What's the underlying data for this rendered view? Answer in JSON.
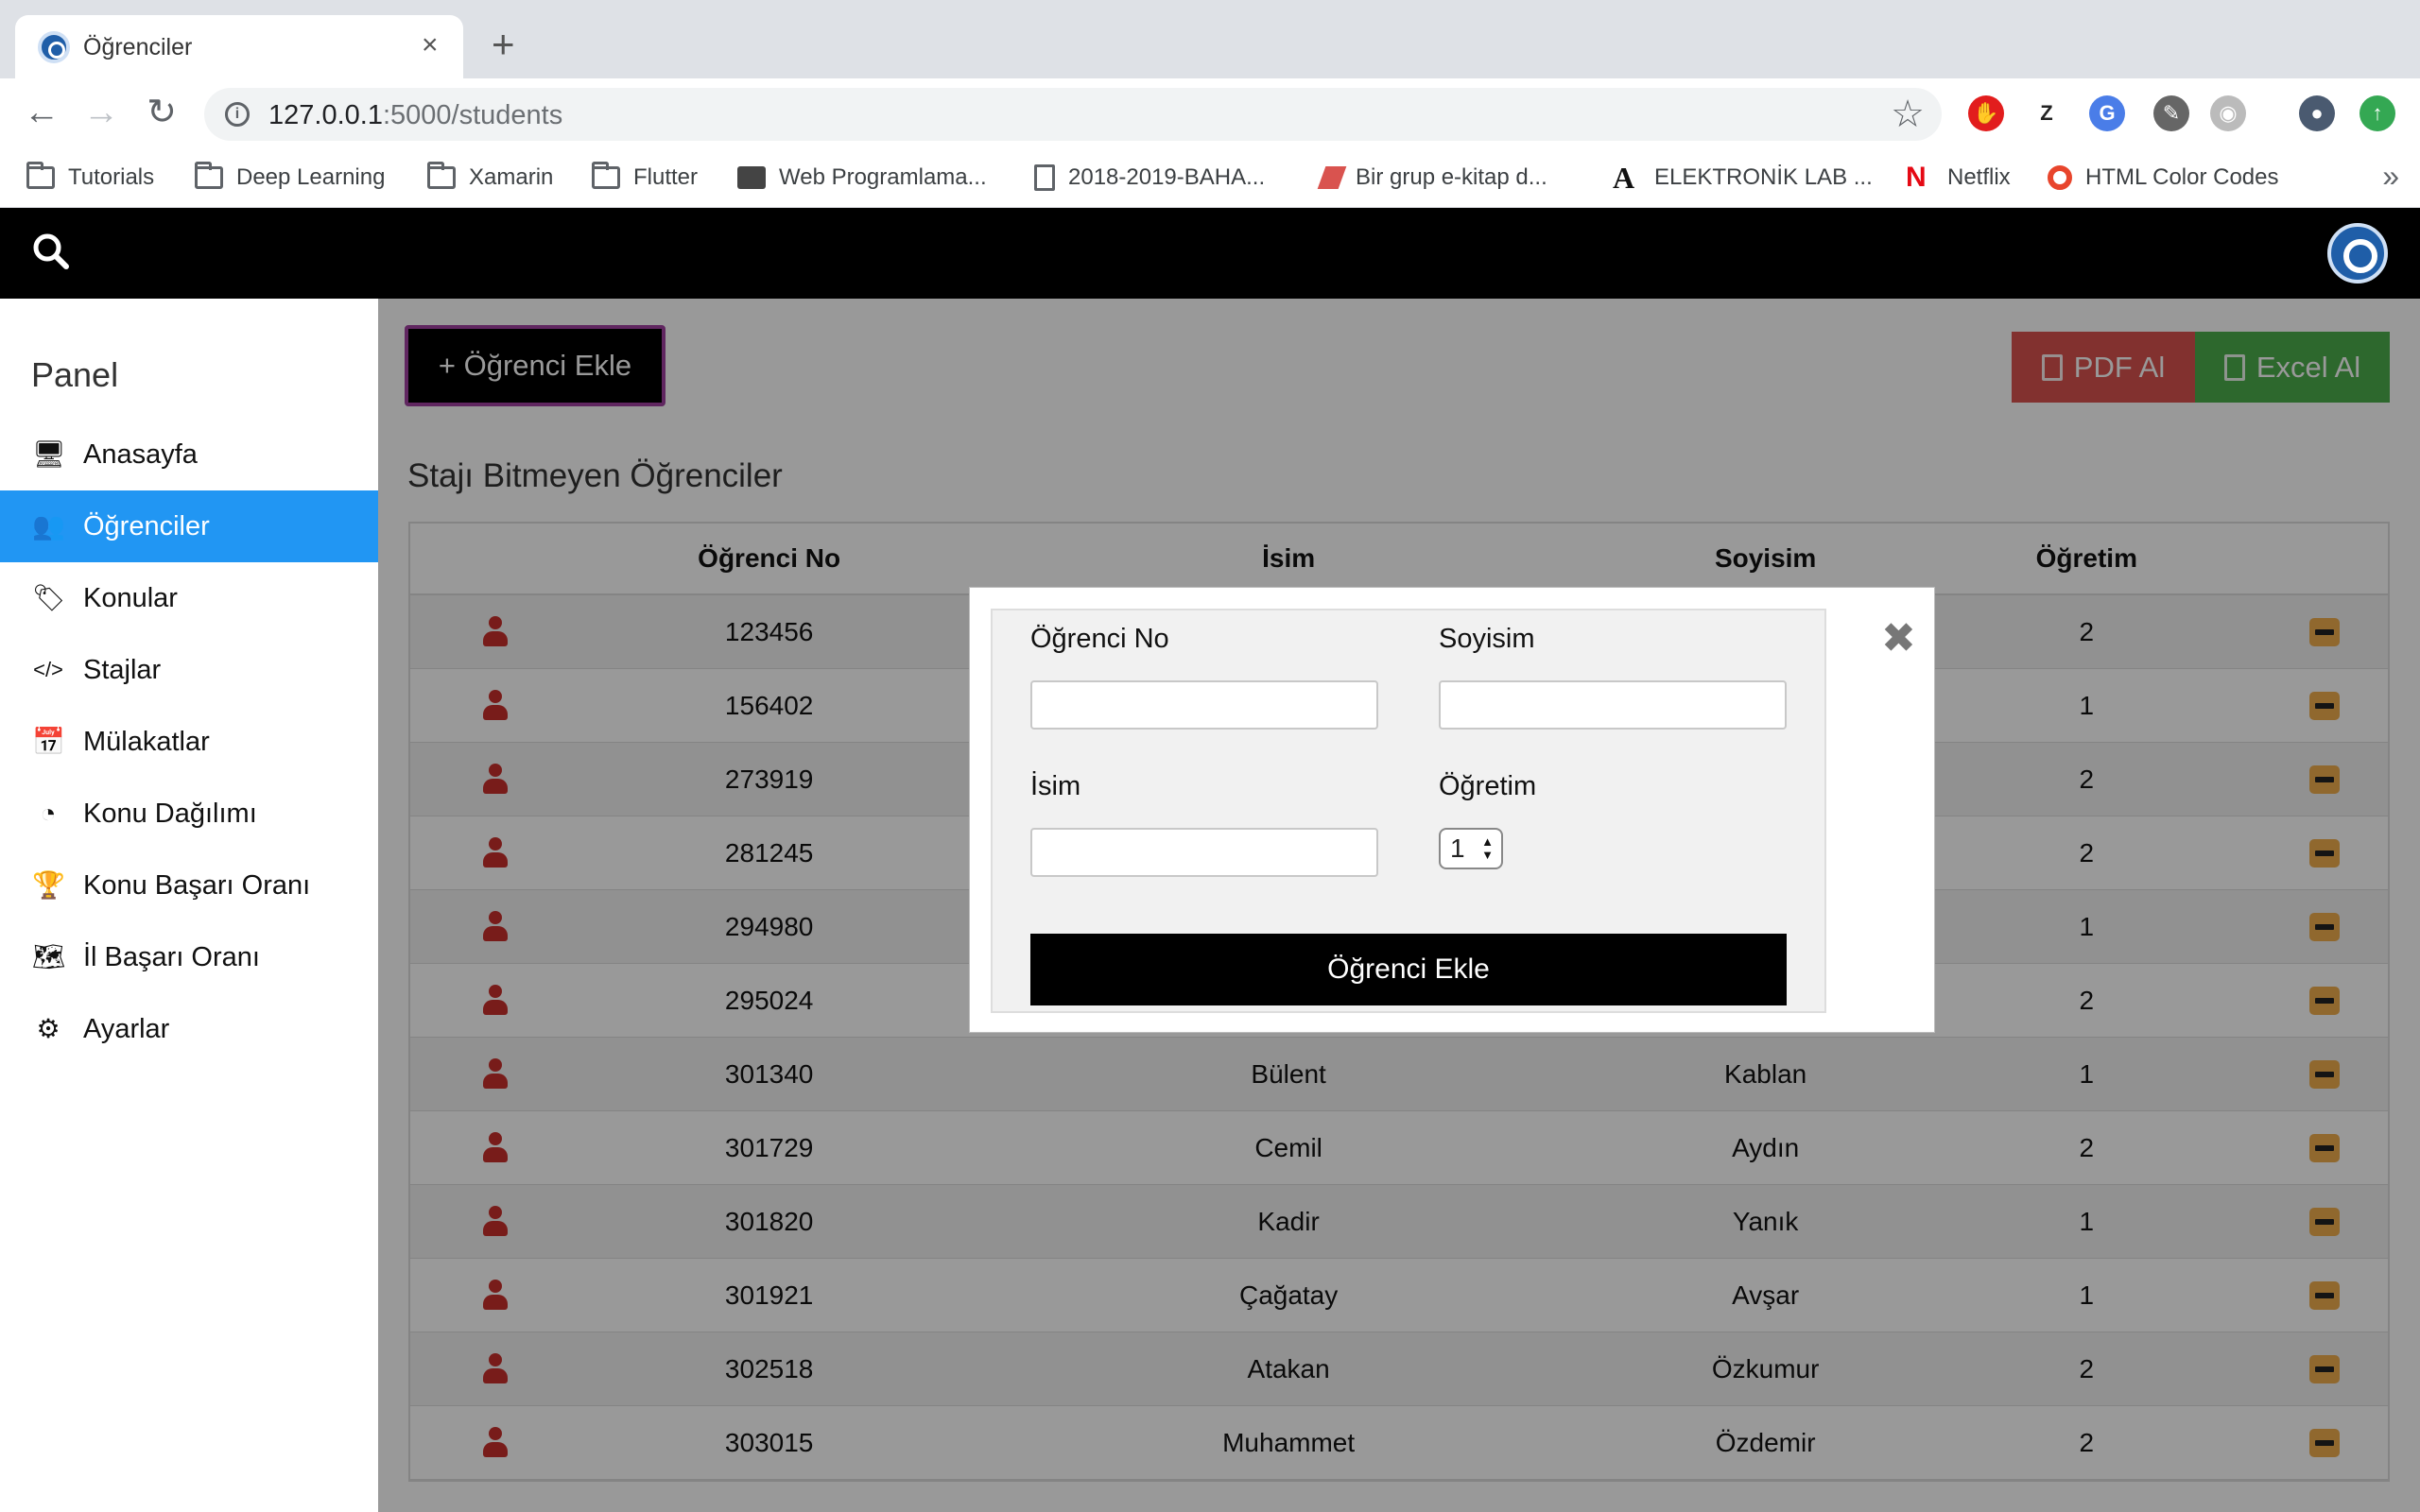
{
  "browser": {
    "tab_title": "Öğrenciler",
    "tab_close": "×",
    "new_tab": "+",
    "url_host": "127.0.0.1",
    "url_path": ":5000/students",
    "bookmarks": [
      {
        "label": "Tutorials",
        "icon": "folder-icon"
      },
      {
        "label": "Deep Learning",
        "icon": "folder-icon"
      },
      {
        "label": "Xamarin",
        "icon": "folder-icon"
      },
      {
        "label": "Flutter",
        "icon": "folder-icon"
      },
      {
        "label": "Web Programlama...",
        "icon": "site-icon"
      },
      {
        "label": "2018-2019-BAHA...",
        "icon": "document-icon"
      },
      {
        "label": "Bir grup e-kitap d...",
        "icon": "book-icon"
      },
      {
        "label": "ELEKTRONİK LAB ...",
        "icon": "letter-a-icon"
      },
      {
        "label": "Netflix",
        "icon": "netflix-icon"
      },
      {
        "label": "HTML Color Codes",
        "icon": "color-wheel-icon"
      }
    ],
    "bookmarks_more": "»",
    "extensions": [
      {
        "name": "adblock-icon",
        "glyph": "✋",
        "color": "#e21d1d"
      },
      {
        "name": "zotero-icon",
        "glyph": "Z",
        "color": "#222222"
      },
      {
        "name": "translate-icon",
        "glyph": "G",
        "color": "#4a7de8"
      },
      {
        "name": "eyedropper-icon",
        "glyph": "✎",
        "color": "#666666"
      },
      {
        "name": "camera-icon",
        "glyph": "◉",
        "color": "#bbbbbb"
      },
      {
        "name": "profile-avatar-icon",
        "glyph": "●",
        "color": "#4a5a70"
      },
      {
        "name": "update-icon",
        "glyph": "↑",
        "color": "#34a853"
      }
    ]
  },
  "sidebar": {
    "title": "Panel",
    "items": [
      {
        "label": "Anasayfa",
        "icon": "desktop-icon",
        "glyph": "🖥",
        "active": false
      },
      {
        "label": "Öğrenciler",
        "icon": "users-icon",
        "glyph": "👥",
        "active": true
      },
      {
        "label": "Konular",
        "icon": "tags-icon",
        "glyph": "🏷",
        "active": false
      },
      {
        "label": "Stajlar",
        "icon": "code-icon",
        "glyph": "</>",
        "active": false
      },
      {
        "label": "Mülakatlar",
        "icon": "calendar-icon",
        "glyph": "📅",
        "active": false
      },
      {
        "label": "Konu Dağılımı",
        "icon": "pie-chart-icon",
        "glyph": "◔",
        "active": false
      },
      {
        "label": "Konu Başarı Oranı",
        "icon": "trophy-icon",
        "glyph": "🏆",
        "active": false
      },
      {
        "label": "İl Başarı Oranı",
        "icon": "map-icon",
        "glyph": "🗺",
        "active": false
      },
      {
        "label": "Ayarlar",
        "icon": "gear-icon",
        "glyph": "⚙",
        "active": false
      }
    ]
  },
  "main": {
    "add_button": "+ Öğrenci Ekle",
    "pdf_button": "PDF Al",
    "excel_button": "Excel Al",
    "section_title": "Stajı Bitmeyen Öğrenciler",
    "columns": [
      "Öğrenci No",
      "İsim",
      "Soyisim",
      "Öğretim"
    ],
    "rows": [
      {
        "no": "123456",
        "name": "",
        "surname": "",
        "ogretim": "2"
      },
      {
        "no": "156402",
        "name": "",
        "surname": "",
        "ogretim": "1"
      },
      {
        "no": "273919",
        "name": "",
        "surname": "",
        "ogretim": "2"
      },
      {
        "no": "281245",
        "name": "",
        "surname": "",
        "ogretim": "2"
      },
      {
        "no": "294980",
        "name": "",
        "surname": "",
        "ogretim": "1"
      },
      {
        "no": "295024",
        "name": "",
        "surname": "",
        "ogretim": "2"
      },
      {
        "no": "301340",
        "name": "Bülent",
        "surname": "Kablan",
        "ogretim": "1"
      },
      {
        "no": "301729",
        "name": "Cemil",
        "surname": "Aydın",
        "ogretim": "2"
      },
      {
        "no": "301820",
        "name": "Kadir",
        "surname": "Yanık",
        "ogretim": "1"
      },
      {
        "no": "301921",
        "name": "Çağatay",
        "surname": "Avşar",
        "ogretim": "1"
      },
      {
        "no": "302518",
        "name": "Atakan",
        "surname": "Özkumur",
        "ogretim": "2"
      },
      {
        "no": "303015",
        "name": "Muhammet",
        "surname": "Özdemir",
        "ogretim": "2"
      }
    ]
  },
  "modal": {
    "close": "✖",
    "label_no": "Öğrenci No",
    "label_surname": "Soyisim",
    "label_name": "İsim",
    "label_ogretim": "Öğretim",
    "value_no": "",
    "value_surname": "",
    "value_name": "",
    "value_ogretim": "1",
    "submit": "Öğrenci Ekle"
  },
  "colors": {
    "active_nav": "#2196f3",
    "pdf": "#d9534f",
    "excel": "#4cae4c",
    "action": "#f0ad4e",
    "user_icon": "#c9302c"
  }
}
